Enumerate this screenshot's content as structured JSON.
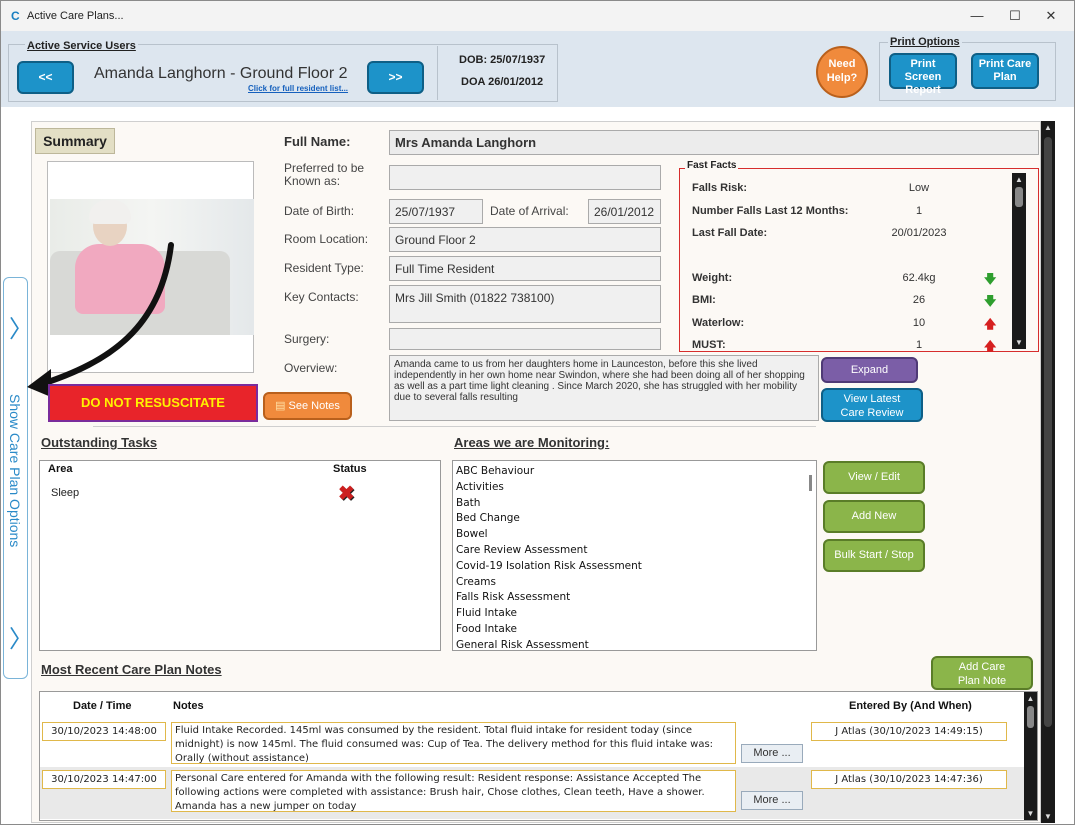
{
  "window": {
    "title": "Active Care Plans...",
    "app_icon": "C",
    "minimize": "—",
    "maximize": "☐",
    "close": "✕"
  },
  "header": {
    "service_users_legend": "Active Service Users",
    "prev_label": "<<",
    "next_label": ">>",
    "resident_name": "Amanda Langhorn - Ground Floor 2",
    "resident_list_link": "Click for full resident list...",
    "dob": "DOB: 25/07/1937",
    "doa": "DOA 26/01/2012",
    "help_label_1": "Need",
    "help_label_2": "Help?",
    "print_legend": "Print Options",
    "print_screen_1": "Print Screen",
    "print_screen_2": "Report",
    "print_plan_1": "Print Care",
    "print_plan_2": "Plan"
  },
  "side_tab": {
    "label": "Show Care Plan Options",
    "chevron": "〉"
  },
  "summary": {
    "tab_label": "Summary",
    "dnr_label": "DO NOT RESUSCITATE",
    "see_notes_label": "See Notes",
    "full_name_label": "Full Name:",
    "full_name": "Mrs Amanda Langhorn",
    "preferred_label": "Preferred to be Known as:",
    "preferred": "",
    "dob_label": "Date of Birth:",
    "dob": "25/07/1937",
    "arrival_label": "Date of Arrival:",
    "arrival": "26/01/2012",
    "room_label": "Room Location:",
    "room": "Ground Floor 2",
    "type_label": "Resident Type:",
    "type": "Full Time Resident",
    "contacts_label": "Key Contacts:",
    "contacts": "Mrs Jill Smith (01822 738100)",
    "surgery_label": "Surgery:",
    "surgery": "",
    "overview_label": "Overview:",
    "overview": "Amanda came to us from her daughters home in Launceston, before this she lived independently in her own home near Swindon, where she had been doing all of her shopping as well as a part time light cleaning . Since March 2020, she has struggled with her mobility due to several falls resulting",
    "expand_label": "Expand",
    "review_label_1": "View Latest",
    "review_label_2": "Care Review"
  },
  "fast_facts": {
    "legend": "Fast Facts",
    "items": [
      {
        "label": "Falls Risk:",
        "value": "Low",
        "arrow": ""
      },
      {
        "label": "Number Falls Last 12 Months:",
        "value": "1",
        "arrow": ""
      },
      {
        "label": "Last Fall Date:",
        "value": "20/01/2023",
        "arrow": ""
      },
      {
        "label": "Weight:",
        "value": "62.4kg",
        "arrow": "down"
      },
      {
        "label": "BMI:",
        "value": "26",
        "arrow": "down"
      },
      {
        "label": "Waterlow:",
        "value": "10",
        "arrow": "up"
      },
      {
        "label": "MUST:",
        "value": "1",
        "arrow": "up"
      }
    ],
    "arrow_down_color": "#2e9e2e",
    "arrow_up_color": "#d62020"
  },
  "tasks": {
    "title": "Outstanding Tasks",
    "col_area": "Area",
    "col_status": "Status",
    "rows": [
      {
        "area": "Sleep",
        "status": "incomplete"
      }
    ]
  },
  "monitoring": {
    "title": "Areas we are Monitoring:",
    "items": [
      "ABC Behaviour",
      "Activities",
      "Bath",
      "Bed Change",
      "Bowel",
      "Care Review Assessment",
      "Covid-19 Isolation Risk Assessment",
      "Creams",
      "Falls Risk Assessment",
      "Fluid Intake",
      "Food Intake",
      "General Risk Assessment"
    ],
    "view_edit_label": "View / Edit",
    "add_new_label": "Add New",
    "bulk_label": "Bulk Start / Stop"
  },
  "notes": {
    "title": "Most Recent Care Plan Notes",
    "add_label_1": "Add Care",
    "add_label_2": "Plan Note",
    "col_date": "Date / Time",
    "col_notes": "Notes",
    "col_by": "Entered By (And When)",
    "more_label": "More ...",
    "rows": [
      {
        "date": "30/10/2023 14:48:00",
        "text": "Fluid Intake Recorded. 145ml was consumed by the resident. Total fluid intake for resident today (since midnight) is now 145ml. The fluid consumed was: Cup of Tea. The delivery method for this fluid intake was: Orally (without assistance)",
        "by": "J Atlas (30/10/2023 14:49:15)"
      },
      {
        "date": "30/10/2023 14:47:00",
        "text": "Personal Care entered for Amanda with the following result: Resident response: Assistance Accepted The following actions were completed with assistance: Brush hair, Chose clothes, Clean teeth, Have a shower. Amanda has a new jumper on today",
        "by": "J Atlas (30/10/2023 14:47:36)"
      }
    ]
  },
  "colors": {
    "header_bg": "#dde6ef",
    "blue_button": "#1d93c9",
    "green_button": "#8bb54a",
    "orange_button": "#f08a3c",
    "dnr_red": "#e8242a",
    "dnr_text": "#fff200"
  }
}
